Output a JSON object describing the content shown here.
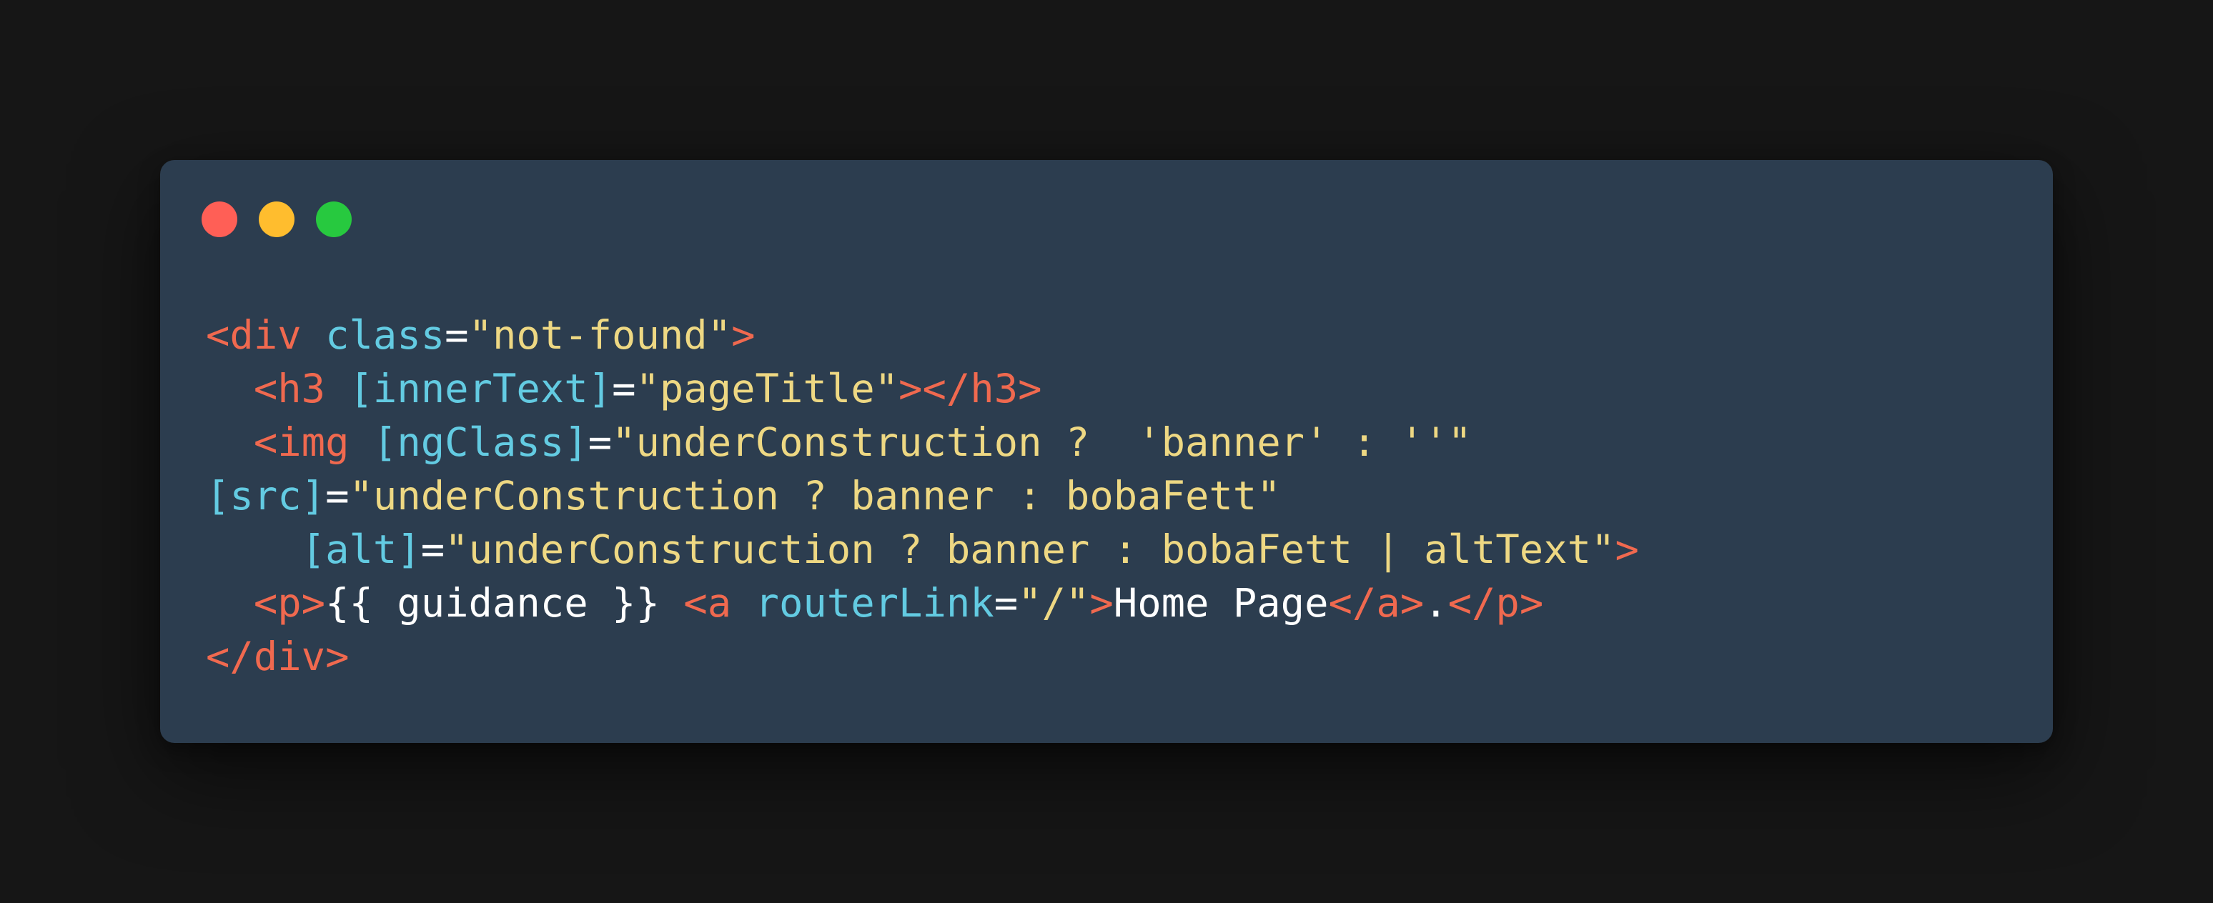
{
  "window": {
    "controls": {
      "close_color": "#ff5f56",
      "minimize_color": "#ffbd2e",
      "maximize_color": "#27c93f"
    }
  },
  "code": {
    "lines": [
      [
        {
          "cls": "t",
          "text": "<div"
        },
        {
          "cls": "p",
          "text": " "
        },
        {
          "cls": "a",
          "text": "class"
        },
        {
          "cls": "p",
          "text": "="
        },
        {
          "cls": "s",
          "text": "\"not-found\""
        },
        {
          "cls": "t",
          "text": ">"
        }
      ],
      [
        {
          "cls": "p",
          "text": "  "
        },
        {
          "cls": "t",
          "text": "<h3"
        },
        {
          "cls": "p",
          "text": " "
        },
        {
          "cls": "a",
          "text": "[innerText]"
        },
        {
          "cls": "p",
          "text": "="
        },
        {
          "cls": "s",
          "text": "\"pageTitle\""
        },
        {
          "cls": "t",
          "text": "></h3>"
        }
      ],
      [
        {
          "cls": "p",
          "text": "  "
        },
        {
          "cls": "t",
          "text": "<img"
        },
        {
          "cls": "p",
          "text": " "
        },
        {
          "cls": "a",
          "text": "[ngClass]"
        },
        {
          "cls": "p",
          "text": "="
        },
        {
          "cls": "s",
          "text": "\"underConstruction ?  'banner' : ''\""
        }
      ],
      [
        {
          "cls": "a",
          "text": "[src]"
        },
        {
          "cls": "p",
          "text": "="
        },
        {
          "cls": "s",
          "text": "\"underConstruction ? banner : bobaFett\""
        }
      ],
      [
        {
          "cls": "p",
          "text": "    "
        },
        {
          "cls": "a",
          "text": "[alt]"
        },
        {
          "cls": "p",
          "text": "="
        },
        {
          "cls": "s",
          "text": "\"underConstruction ? banner : bobaFett | altText\""
        },
        {
          "cls": "t",
          "text": ">"
        }
      ],
      [
        {
          "cls": "p",
          "text": "  "
        },
        {
          "cls": "t",
          "text": "<p>"
        },
        {
          "cls": "p",
          "text": "{{ guidance }} "
        },
        {
          "cls": "t",
          "text": "<a"
        },
        {
          "cls": "p",
          "text": " "
        },
        {
          "cls": "a",
          "text": "routerLink"
        },
        {
          "cls": "p",
          "text": "="
        },
        {
          "cls": "s",
          "text": "\"/\""
        },
        {
          "cls": "t",
          "text": ">"
        },
        {
          "cls": "p",
          "text": "Home Page"
        },
        {
          "cls": "t",
          "text": "</a>"
        },
        {
          "cls": "p",
          "text": "."
        },
        {
          "cls": "t",
          "text": "</p>"
        }
      ],
      [
        {
          "cls": "t",
          "text": "</div>"
        }
      ]
    ]
  }
}
